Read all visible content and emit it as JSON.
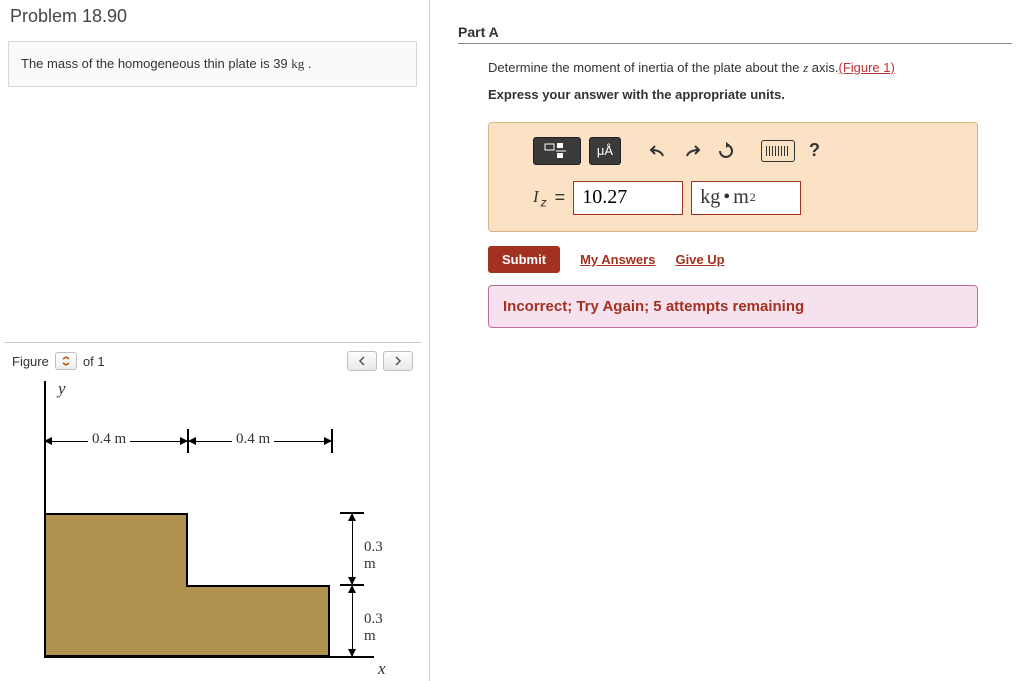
{
  "left": {
    "title": "Problem 18.90",
    "intro_prefix": "The mass of the homogeneous thin plate is 39 ",
    "intro_unit": "kg",
    "intro_suffix": " .",
    "figure": {
      "label_prefix": "Figure",
      "current": "1",
      "of_label": "of 1",
      "dims": {
        "h_left": "0.4 m",
        "h_right": "0.4 m",
        "v_top": "0.3 m",
        "v_bottom": "0.3 m"
      },
      "x_axis": "x",
      "y_axis": "y"
    }
  },
  "right": {
    "part_title": "Part A",
    "prompt_pre": "Determine the moment of inertia of the plate about the ",
    "prompt_var": "z",
    "prompt_post": " axis.",
    "figlink": "(Figure 1)",
    "express": "Express your answer with the appropriate units.",
    "toolbar": {
      "mu_label": "μÅ"
    },
    "answer": {
      "var": "I",
      "sub": "z",
      "eq": "=",
      "value": "10.27",
      "unit_main": "kg",
      "unit_dot": "•",
      "unit_m": "m",
      "unit_exp": "2"
    },
    "actions": {
      "submit": "Submit",
      "my_answers": "My Answers",
      "give_up": "Give Up"
    },
    "feedback": "Incorrect; Try Again; 5 attempts remaining"
  }
}
